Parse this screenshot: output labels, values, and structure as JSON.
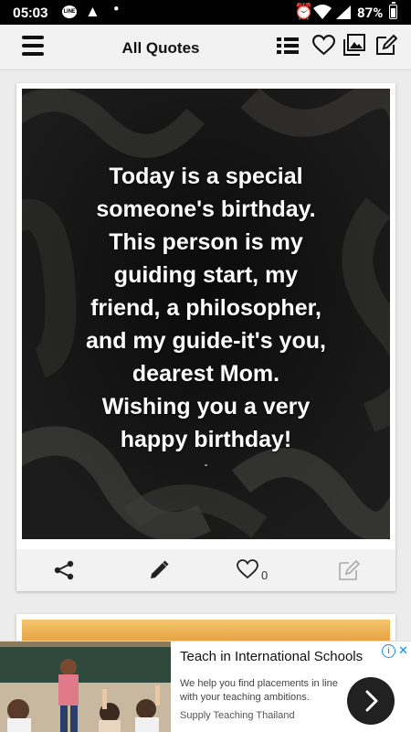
{
  "status_bar": {
    "time": "05:03",
    "line_badge": "LINE",
    "battery_percent": "87%",
    "battery_level": 0.87
  },
  "app_bar": {
    "title": "All Quotes",
    "icons": [
      "menu-icon",
      "list-icon",
      "heart-icon",
      "gallery-icon",
      "edit-icon"
    ]
  },
  "quote_card": {
    "lines": [
      "Today is a special",
      "someone's birthday.",
      "This person is my",
      "guiding start, my",
      "friend, a philosopher,",
      "and my guide-it's you,",
      "dearest Mom.",
      "Wishing you a very",
      "happy birthday!"
    ],
    "author": "-",
    "likes": "0",
    "actions": [
      "share-icon",
      "pencil-icon",
      "heart-icon",
      "edit-note-icon"
    ]
  },
  "ad": {
    "headline": "Teach in International Schools",
    "description": "We help you find placements in line with your teaching ambitions.",
    "advertiser": "Supply Teaching Thailand",
    "accent": "#1a8ce0"
  }
}
